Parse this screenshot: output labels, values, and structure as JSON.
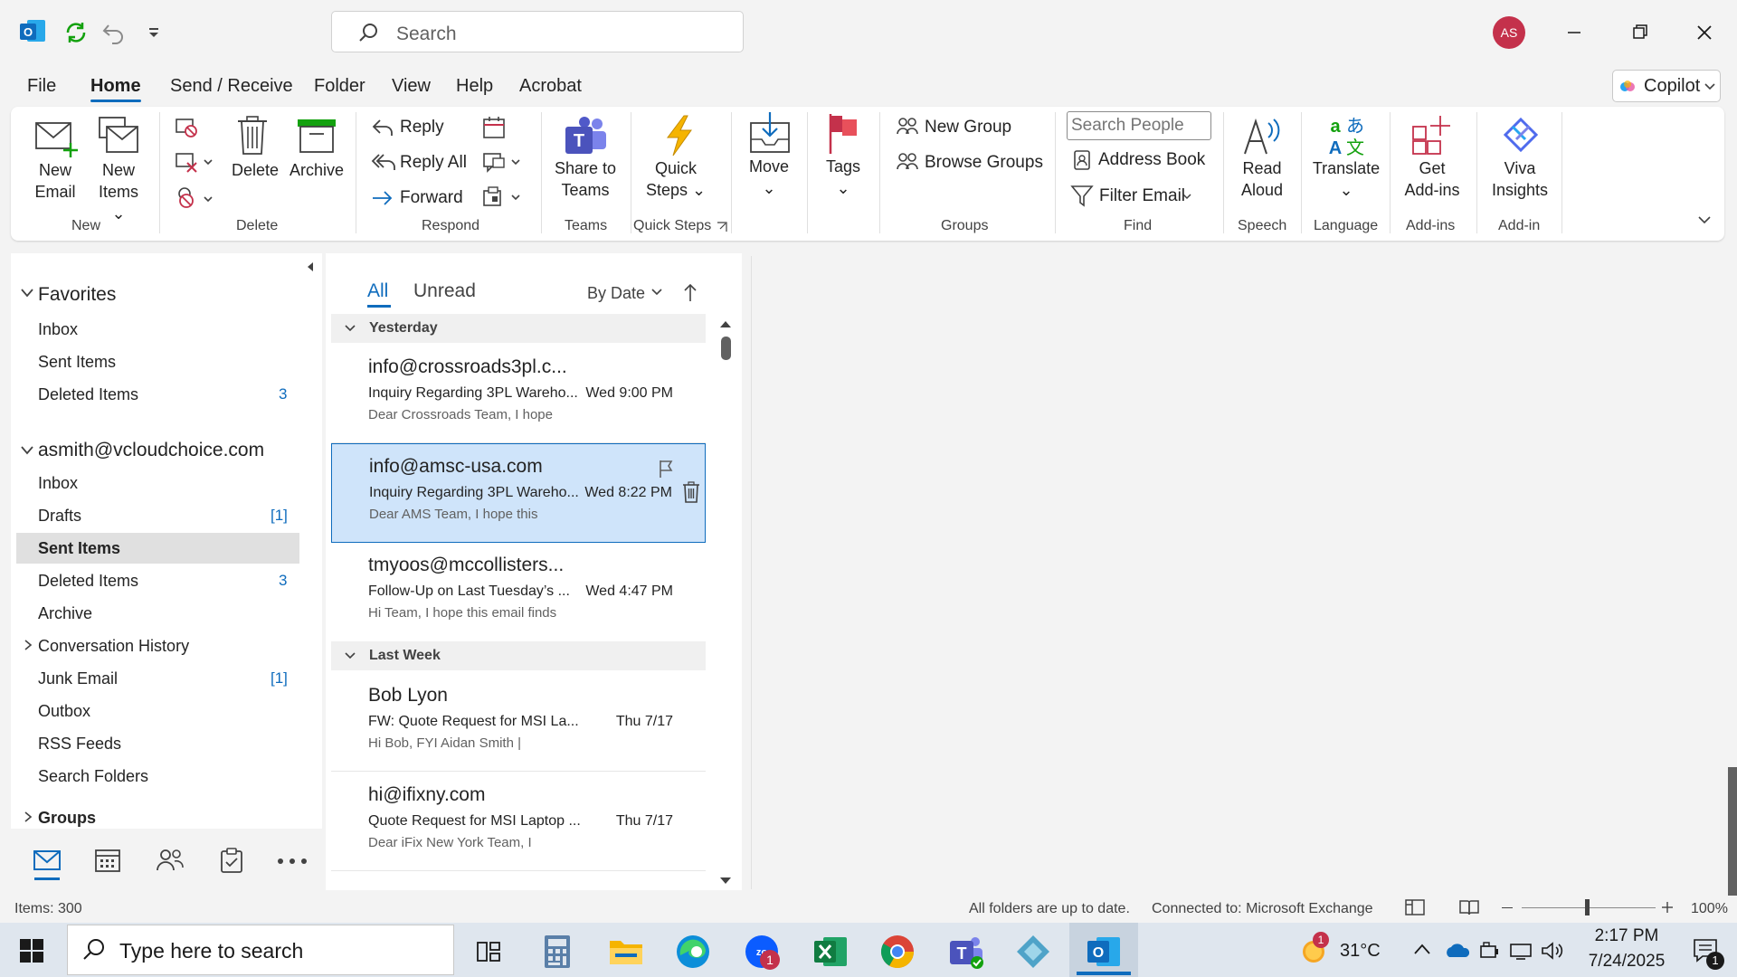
{
  "titlebar": {
    "search_placeholder": "Search",
    "avatar_initials": "AS"
  },
  "menu": {
    "tabs": [
      "File",
      "Home",
      "Send / Receive",
      "Folder",
      "View",
      "Help",
      "Acrobat"
    ],
    "active": "Home",
    "copilot_label": "Copilot"
  },
  "ribbon": {
    "new_email": [
      "New",
      "Email"
    ],
    "new_items": [
      "New",
      "Items"
    ],
    "delete": "Delete",
    "archive": "Archive",
    "reply": "Reply",
    "reply_all": "Reply All",
    "forward": "Forward",
    "share_teams": [
      "Share to",
      "Teams"
    ],
    "quick_steps": [
      "Quick",
      "Steps"
    ],
    "move": "Move",
    "tags": "Tags",
    "new_group": "New Group",
    "browse_groups": "Browse Groups",
    "search_people_placeholder": "Search People",
    "address_book": "Address Book",
    "filter_email": "Filter Email",
    "read_aloud": [
      "Read",
      "Aloud"
    ],
    "translate": "Translate",
    "get_addins": [
      "Get",
      "Add-ins"
    ],
    "viva": [
      "Viva",
      "Insights"
    ],
    "groups": {
      "new": "New",
      "delete": "Delete",
      "respond": "Respond",
      "teams": "Teams",
      "quick_steps": "Quick Steps",
      "groups": "Groups",
      "find": "Find",
      "speech": "Speech",
      "language": "Language",
      "addins": "Add-ins",
      "addin": "Add-in"
    }
  },
  "folders": {
    "favorites_header": "Favorites",
    "favorites": [
      {
        "label": "Inbox",
        "count": ""
      },
      {
        "label": "Sent Items",
        "count": ""
      },
      {
        "label": "Deleted Items",
        "count": "3"
      }
    ],
    "account": "asmith@vcloudchoice.com",
    "items": [
      {
        "label": "Inbox",
        "count": ""
      },
      {
        "label": "Drafts",
        "count": "[1]"
      },
      {
        "label": "Sent Items",
        "count": ""
      },
      {
        "label": "Deleted Items",
        "count": "3"
      },
      {
        "label": "Archive",
        "count": ""
      },
      {
        "label": "Conversation History",
        "count": ""
      },
      {
        "label": "Junk Email",
        "count": "[1]"
      },
      {
        "label": "Outbox",
        "count": ""
      },
      {
        "label": "RSS Feeds",
        "count": ""
      },
      {
        "label": "Search Folders",
        "count": ""
      }
    ],
    "groups_header": "Groups",
    "selected": "Sent Items"
  },
  "messagelist": {
    "tab_all": "All",
    "tab_unread": "Unread",
    "sort_label": "By Date",
    "section_yesterday": "Yesterday",
    "section_lastweek": "Last Week",
    "messages": [
      {
        "from": "info@crossroads3pl.c...",
        "subject": "Inquiry Regarding 3PL Wareho...",
        "preview": "Dear Crossroads Team,  I hope",
        "time": "Wed 9:00 PM"
      },
      {
        "from": "info@amsc-usa.com",
        "subject": "Inquiry Regarding 3PL Wareho...",
        "preview": "Dear AMS Team,  I hope this",
        "time": "Wed 8:22 PM"
      },
      {
        "from": "tmyoos@mccollisters...",
        "subject": "Follow-Up on Last Tuesday’s ...",
        "preview": "Hi Team,  I hope this email finds",
        "time": "Wed 4:47 PM"
      },
      {
        "from": "Bob Lyon",
        "subject": "FW: Quote Request for MSI La...",
        "preview": "Hi Bob,  FYI  Aidan Smith |",
        "time": "Thu 7/17"
      },
      {
        "from": "hi@ifixny.com",
        "subject": "Quote Request for MSI Laptop ...",
        "preview": "Dear iFix New York Team,  I",
        "time": "Thu 7/17"
      }
    ]
  },
  "status": {
    "items": "Items: 300",
    "sync": "All folders are up to date.",
    "connection": "Connected to: Microsoft Exchange",
    "zoom": "100%"
  },
  "taskbar": {
    "search_placeholder": "Type here to search",
    "weather": "31°C",
    "time": "2:17 PM",
    "date": "7/24/2025",
    "weather_badge": "1",
    "zoom_badge": "1",
    "notif_badge": "1"
  },
  "colors": {
    "accent": "#0f6cbd",
    "selected_bg": "#cfe4fa",
    "avatar": "#c4314b"
  }
}
